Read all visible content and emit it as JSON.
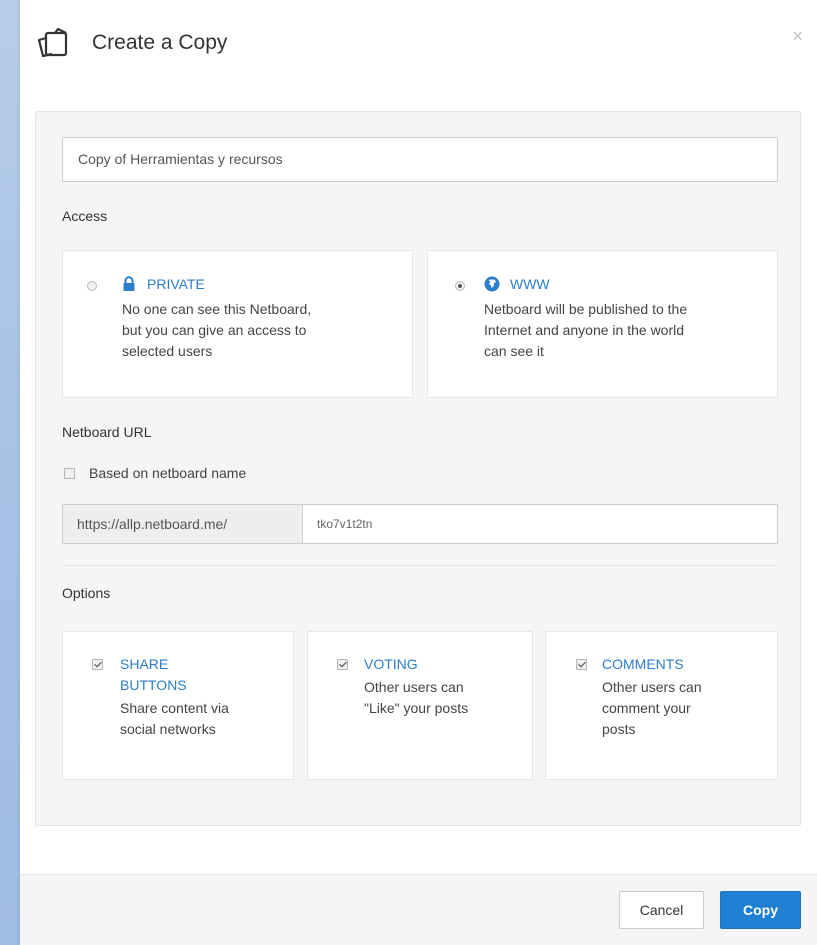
{
  "dialog": {
    "title": "Create a Copy",
    "close_label": "×"
  },
  "name_input": {
    "value": "Copy of Herramientas y recursos"
  },
  "access": {
    "label": "Access",
    "options": [
      {
        "title": "PRIVATE",
        "icon": "lock-icon",
        "selected": false,
        "description_lines": [
          "No one can see this Netboard,",
          "but you can give an access to",
          "selected users"
        ]
      },
      {
        "title": "WWW",
        "icon": "globe-icon",
        "selected": true,
        "description_lines": [
          "Netboard will be published to the",
          "Internet and anyone in the world",
          "can see it"
        ]
      }
    ]
  },
  "netboard_url": {
    "label": "Netboard URL",
    "based_on_name_label": "Based on netboard name",
    "based_on_name_checked": false,
    "prefix": "https://allp.netboard.me/",
    "slug": "tko7v1t2tn"
  },
  "options": {
    "label": "Options",
    "items": [
      {
        "title_lines": [
          "SHARE",
          "BUTTONS"
        ],
        "checked": true,
        "description_lines": [
          "Share content via",
          "social networks"
        ]
      },
      {
        "title_lines": [
          "VOTING"
        ],
        "checked": true,
        "description_lines": [
          "Other users can",
          "\"Like\" your posts"
        ]
      },
      {
        "title_lines": [
          "COMMENTS"
        ],
        "checked": true,
        "description_lines": [
          "Other users can",
          "comment your",
          "posts"
        ]
      }
    ]
  },
  "footer": {
    "cancel_label": "Cancel",
    "copy_label": "Copy"
  },
  "colors": {
    "accent": "#2b7dc9",
    "primary_button": "#1f80d3",
    "background": "#a9c3e6"
  }
}
